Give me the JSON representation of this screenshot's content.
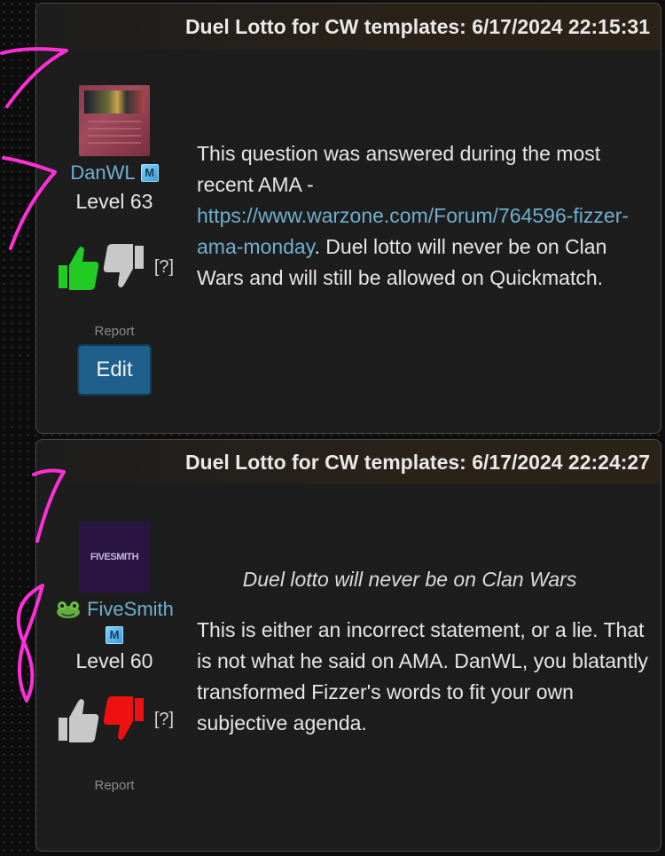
{
  "posts": [
    {
      "header": "Duel Lotto for CW templates: 6/17/2024 22:15:31",
      "author": {
        "name": "DanWL",
        "member_badge": "M",
        "level": "Level 63"
      },
      "votes": {
        "help": "[?]",
        "up_color": "#22cc22",
        "down_color": "#c8c8c8"
      },
      "report": "Report",
      "edit": "Edit",
      "body": {
        "before_link": "This question was answered during the most recent AMA - ",
        "link": "https://www.warzone.com/Forum/764596-fizzer-ama-monday",
        "after_link": ". Duel lotto will never be on Clan Wars and will still be allowed on Quickmatch."
      }
    },
    {
      "header": "Duel Lotto for CW templates: 6/17/2024 22:24:27",
      "author": {
        "name": "FiveSmith",
        "avatar_text": "FIVESMITH",
        "member_badge": "M",
        "level": "Level 60"
      },
      "votes": {
        "help": "[?]",
        "up_color": "#c8c8c8",
        "down_color": "#ee1111"
      },
      "report": "Report",
      "body": {
        "quote": "Duel lotto will never be on Clan Wars",
        "text": "This is either an incorrect statement, or a lie. That is not what he said on AMA. DanWL, you blatantly transformed Fizzer's words to fit your own subjective agenda."
      }
    }
  ],
  "annotation_color": "#ff2fd8"
}
